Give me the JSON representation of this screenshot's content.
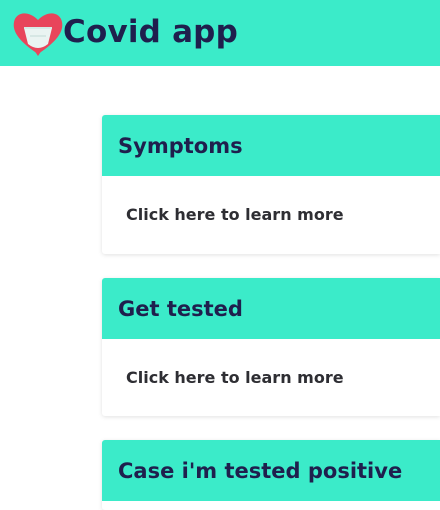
{
  "header": {
    "app_name": "Covid app",
    "logo_icon": "heart-bandage-icon"
  },
  "colors": {
    "accent": "#3bebc9",
    "title_text": "#1f1f4d",
    "body_text": "#2e2e33",
    "logo_heart": "#e8455b"
  },
  "cards": [
    {
      "title": "Symptoms",
      "link": "Click here to learn more"
    },
    {
      "title": "Get tested",
      "link": "Click here to learn more"
    },
    {
      "title": "Case i'm tested positive"
    }
  ]
}
